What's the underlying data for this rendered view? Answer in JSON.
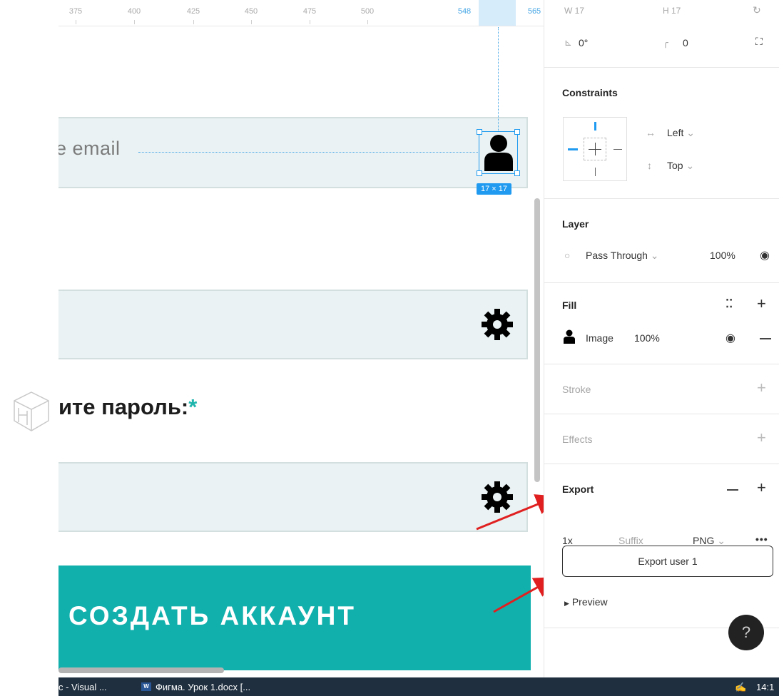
{
  "ruler": {
    "ticks": [
      "375",
      "400",
      "425",
      "450",
      "475",
      "500",
      "548",
      "565"
    ]
  },
  "canvas": {
    "email_placeholder": "e email",
    "size_badge": "17 × 17",
    "password_label": "ите пароль:",
    "required_star": "*",
    "create_button": "СОЗДАТЬ АККАУНТ"
  },
  "panel": {
    "top_values": {
      "w_label": "17",
      "h_label": "17",
      "rotation": "0°",
      "corner_radius": "0"
    },
    "constraints": {
      "title": "Constraints",
      "horizontal": "Left",
      "vertical": "Top"
    },
    "layer": {
      "title": "Layer",
      "blend_mode": "Pass Through",
      "opacity": "100%"
    },
    "fill": {
      "title": "Fill",
      "type": "Image",
      "opacity": "100%"
    },
    "stroke": {
      "title": "Stroke"
    },
    "effects": {
      "title": "Effects"
    },
    "export": {
      "title": "Export",
      "scale": "1x",
      "suffix_placeholder": "Suffix",
      "format": "PNG",
      "more": "•••",
      "button": "Export user 1",
      "preview": "Preview"
    },
    "help": "?"
  },
  "taskbar": {
    "item1": "c - Visual ...",
    "item2": "Фигма. Урок 1.docx [...",
    "clock": "14:1"
  },
  "colors": {
    "accent_blue": "#1f9af0",
    "teal": "#12b0ad",
    "field_bg": "#eaf2f3",
    "taskbar": "#1f2f3f",
    "annotation_red": "#e02020"
  }
}
